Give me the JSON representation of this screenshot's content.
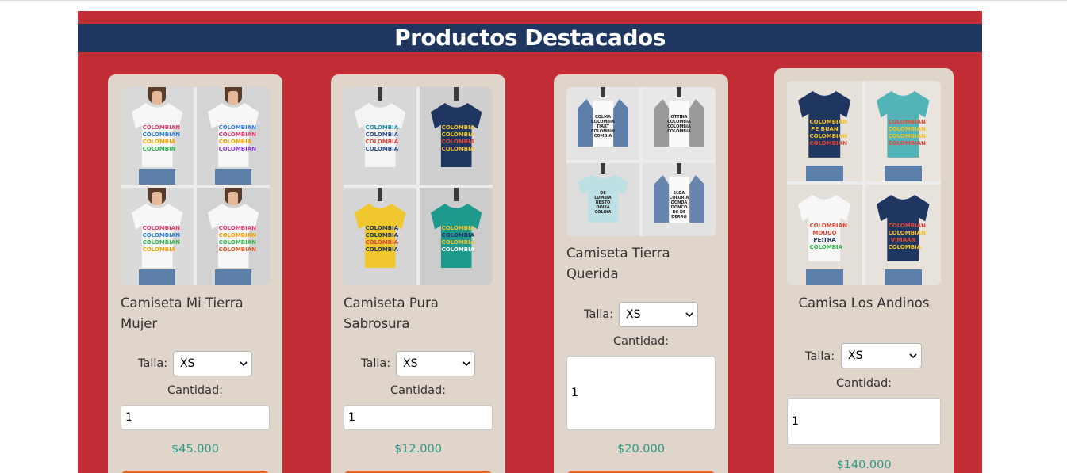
{
  "section": {
    "title": "Productos Destacados"
  },
  "labels": {
    "size": "Talla:",
    "quantity": "Cantidad:"
  },
  "colors": {
    "background": "#c22d35",
    "title_bar": "#1f3660",
    "card": "#e0d5ca",
    "price": "#2b9a84",
    "button": "#e0672e"
  },
  "products": [
    {
      "name": "Camiseta Mi Tierra Mujer",
      "size": "XS",
      "quantity": "1",
      "price": "$45.000",
      "image": "women-colombian-tshirt-collage"
    },
    {
      "name": "Camiseta Pura Sabrosura",
      "size": "XS",
      "quantity": "1",
      "price": "$12.000",
      "image": "mannequin-colombia-tshirt-collage"
    },
    {
      "name": "Camiseta Tierra Querida",
      "size": "XS",
      "quantity": "1",
      "price": "$20.000",
      "image": "mannequin-white-tshirt-jacket-collage"
    },
    {
      "name": "Camisa Los Andinos",
      "size": "XS",
      "quantity": "1",
      "price": "$140.000",
      "image": "hanging-colombian-shirts-collage"
    }
  ]
}
